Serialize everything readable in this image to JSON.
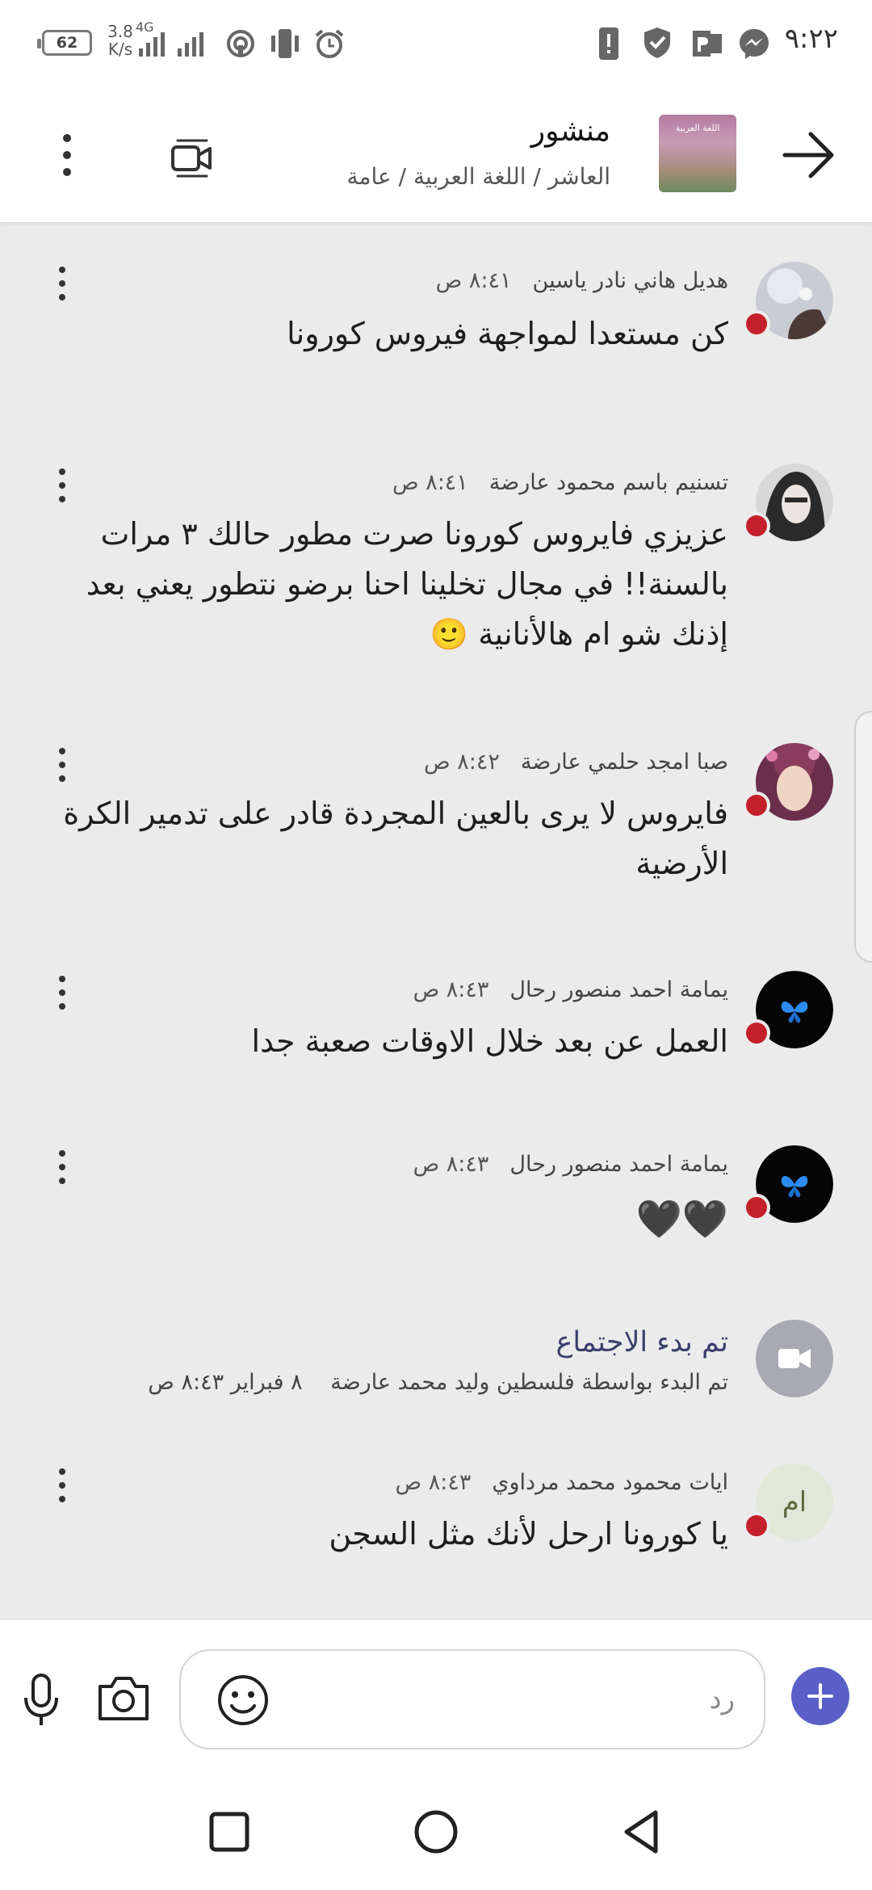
{
  "status_bar": {
    "battery": "62",
    "network_speed": "3.8",
    "network_unit": "K/s",
    "network_type": "4G",
    "time": "٩:٢٢",
    "icons": [
      "battery-icon",
      "signal-icon",
      "hotspot-icon",
      "vibrate-icon",
      "alarm-icon",
      "sim-icon",
      "shield-icon",
      "office-icon",
      "messenger-icon"
    ]
  },
  "header": {
    "title": "منشور",
    "breadcrumb": "العاشر / اللغة العربية / عامة",
    "thumbnail_label": "اللغة العربية",
    "icons": [
      "back-arrow-icon",
      "video-call-icon",
      "more-vertical-icon"
    ]
  },
  "messages": [
    {
      "author": "هديل هاني نادر ياسين",
      "time": "٨:٤١ ص",
      "text": "كن مستعدا لمواجهة فيروس كورونا"
    },
    {
      "author": "تسنيم باسم محمود عارضة",
      "time": "٨:٤١ ص",
      "text": "عزيزي فايروس كورونا صرت مطور حالك ٣ مرات بالسنة!! في مجال تخلينا احنا برضو نتطور يعني بعد إذنك شو ام هالأنانية 🙂"
    },
    {
      "author": "صبا امجد حلمي عارضة",
      "time": "٨:٤٢ ص",
      "text": "فايروس لا يرى بالعين المجردة قادر على تدمير الكرة الأرضية"
    },
    {
      "author": "يمامة احمد منصور رحال",
      "time": "٨:٤٣ ص",
      "text": "العمل عن بعد خلال الاوقات صعبة جدا"
    },
    {
      "author": "يمامة احمد منصور رحال",
      "time": "٨:٤٣ ص",
      "text": "🖤🖤"
    }
  ],
  "meeting": {
    "title": "تم بدء الاجتماع",
    "subtitle": "تم البدء بواسطة فلسطين وليد محمد عارضة",
    "date": "٨ فبراير ٨:٤٣ ص"
  },
  "last_message": {
    "author": "ايات محمود محمد مرداوي",
    "time": "٨:٤٣ ص",
    "initials": "ام",
    "text": "يا كورونا ارحل لأنك مثل السجن"
  },
  "compose": {
    "placeholder": "رد",
    "icons": [
      "microphone-icon",
      "camera-icon",
      "emoji-icon",
      "plus-icon"
    ]
  },
  "nav": {
    "icons": [
      "recents-square-icon",
      "home-circle-icon",
      "back-triangle-icon"
    ]
  },
  "colors": {
    "accent": "#5b5fc7",
    "presence_busy": "#c4202b",
    "background": "#ebebeb",
    "meeting_title": "#3a3f6e"
  }
}
